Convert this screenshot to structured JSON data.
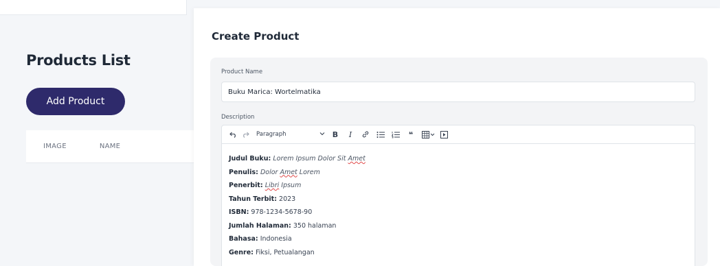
{
  "products_page": {
    "title": "Products List",
    "add_button": "Add Product",
    "columns": [
      "IMAGE",
      "NAME"
    ]
  },
  "modal": {
    "title": "Create Product",
    "product_name_label": "Product Name",
    "product_name_value": "Buku Marica: Wortelmatika",
    "description_label": "Description",
    "toolbar": {
      "paragraph_label": "Paragraph",
      "bold": "B",
      "italic": "I",
      "quote": "❝"
    },
    "description": [
      {
        "label": "Judul Buku:",
        "value_pre": "Lorem Ipsum Dolor Sit ",
        "value_sq": "Amet",
        "italic": true
      },
      {
        "label": "Penulis:",
        "value_pre": "Dolor ",
        "value_sq": "Amet",
        "value_post": " Lorem",
        "italic": true
      },
      {
        "label": "Penerbit:",
        "value_sq": "Libri",
        "value_post": " Ipsum",
        "italic": true
      },
      {
        "label": "Tahun Terbit:",
        "value_pre": "2023",
        "italic": false
      },
      {
        "label": "ISBN:",
        "value_pre": "978-1234-5678-90",
        "italic": false
      },
      {
        "label": "Jumlah Halaman:",
        "value_pre": "350 halaman",
        "italic": false
      },
      {
        "label": "Bahasa:",
        "value_pre": "Indonesia",
        "italic": false
      },
      {
        "label": "Genre:",
        "value_pre": "Fiksi, Petualangan",
        "italic": false
      }
    ]
  },
  "colors": {
    "primary_button": "#2e2a6b",
    "page_bg": "#f4f6f9",
    "spellcheck": "#e04848"
  }
}
